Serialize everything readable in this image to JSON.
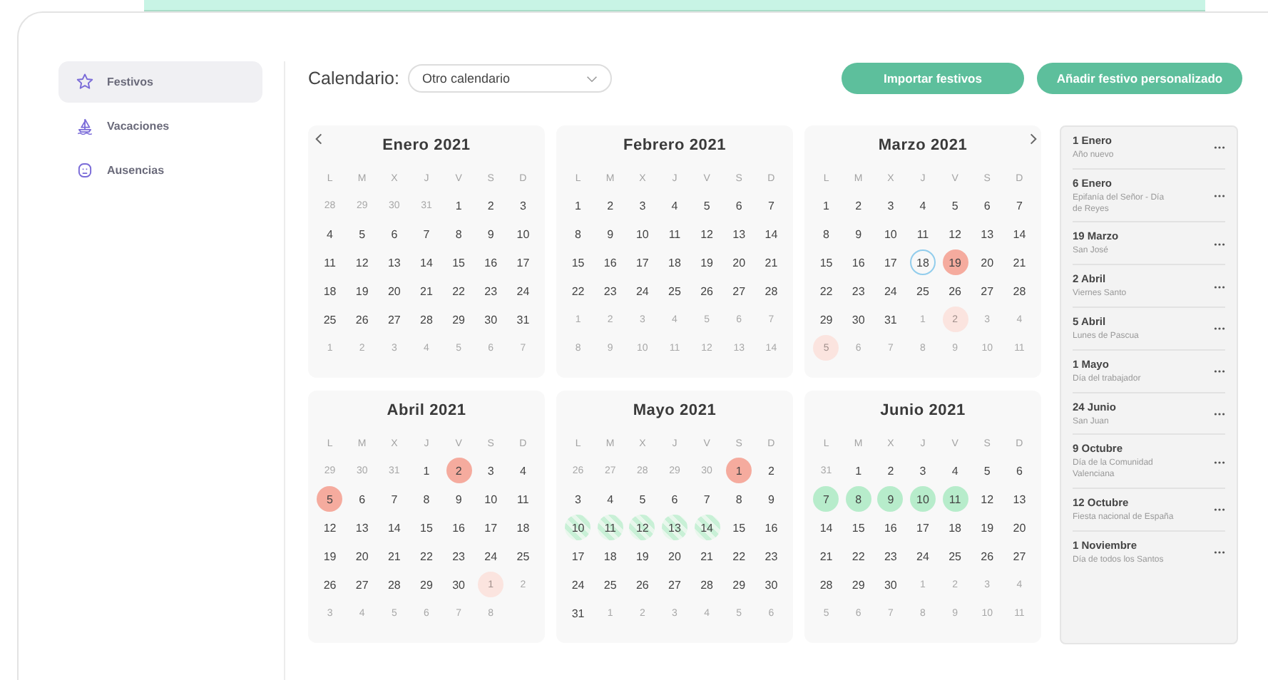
{
  "sidebar": {
    "items": [
      {
        "label": "Festivos",
        "selected": true
      },
      {
        "label": "Vacaciones",
        "selected": false
      },
      {
        "label": "Ausencias",
        "selected": false
      }
    ]
  },
  "toolbar": {
    "calendar_label": "Calendario:",
    "calendar_value": "Otro calendario",
    "buttons": [
      "Importar festivos",
      "Añadir festivo personalizado"
    ]
  },
  "months": [
    {
      "title": "Enero 2021",
      "weekdays": [
        "L",
        "M",
        "X",
        "J",
        "V",
        "S",
        "D"
      ],
      "weeks": [
        [
          {
            "d": "28",
            "kind": "out"
          },
          {
            "d": "29",
            "kind": "out"
          },
          {
            "d": "30",
            "kind": "out"
          },
          {
            "d": "31",
            "kind": "out"
          },
          {
            "d": "1",
            "kind": "in"
          },
          {
            "d": "2",
            "kind": "in"
          },
          {
            "d": "3",
            "kind": "in"
          }
        ],
        [
          {
            "d": "4",
            "kind": "in"
          },
          {
            "d": "5",
            "kind": "in"
          },
          {
            "d": "6",
            "kind": "in"
          },
          {
            "d": "7",
            "kind": "in"
          },
          {
            "d": "8",
            "kind": "in"
          },
          {
            "d": "9",
            "kind": "in"
          },
          {
            "d": "10",
            "kind": "in"
          }
        ],
        [
          {
            "d": "11",
            "kind": "in"
          },
          {
            "d": "12",
            "kind": "in"
          },
          {
            "d": "13",
            "kind": "in"
          },
          {
            "d": "14",
            "kind": "in"
          },
          {
            "d": "15",
            "kind": "in"
          },
          {
            "d": "16",
            "kind": "in"
          },
          {
            "d": "17",
            "kind": "in"
          }
        ],
        [
          {
            "d": "18",
            "kind": "in"
          },
          {
            "d": "19",
            "kind": "in"
          },
          {
            "d": "20",
            "kind": "in"
          },
          {
            "d": "21",
            "kind": "in"
          },
          {
            "d": "22",
            "kind": "in"
          },
          {
            "d": "23",
            "kind": "in"
          },
          {
            "d": "24",
            "kind": "in"
          }
        ],
        [
          {
            "d": "25",
            "kind": "in"
          },
          {
            "d": "26",
            "kind": "in"
          },
          {
            "d": "27",
            "kind": "in"
          },
          {
            "d": "28",
            "kind": "in"
          },
          {
            "d": "29",
            "kind": "in"
          },
          {
            "d": "30",
            "kind": "in"
          },
          {
            "d": "31",
            "kind": "in"
          }
        ],
        [
          {
            "d": "1",
            "kind": "out"
          },
          {
            "d": "2",
            "kind": "out"
          },
          {
            "d": "3",
            "kind": "out"
          },
          {
            "d": "4",
            "kind": "out"
          },
          {
            "d": "5",
            "kind": "out"
          },
          {
            "d": "6",
            "kind": "out"
          },
          {
            "d": "7",
            "kind": "out"
          }
        ]
      ]
    },
    {
      "title": "Febrero 2021",
      "weekdays": [
        "L",
        "M",
        "X",
        "J",
        "V",
        "S",
        "D"
      ],
      "weeks": [
        [
          {
            "d": "1",
            "kind": "in"
          },
          {
            "d": "2",
            "kind": "in"
          },
          {
            "d": "3",
            "kind": "in"
          },
          {
            "d": "4",
            "kind": "in"
          },
          {
            "d": "5",
            "kind": "in"
          },
          {
            "d": "6",
            "kind": "in"
          },
          {
            "d": "7",
            "kind": "in"
          }
        ],
        [
          {
            "d": "8",
            "kind": "in"
          },
          {
            "d": "9",
            "kind": "in"
          },
          {
            "d": "10",
            "kind": "in"
          },
          {
            "d": "11",
            "kind": "in"
          },
          {
            "d": "12",
            "kind": "in"
          },
          {
            "d": "13",
            "kind": "in"
          },
          {
            "d": "14",
            "kind": "in"
          }
        ],
        [
          {
            "d": "15",
            "kind": "in"
          },
          {
            "d": "16",
            "kind": "in"
          },
          {
            "d": "17",
            "kind": "in"
          },
          {
            "d": "18",
            "kind": "in"
          },
          {
            "d": "19",
            "kind": "in"
          },
          {
            "d": "20",
            "kind": "in"
          },
          {
            "d": "21",
            "kind": "in"
          }
        ],
        [
          {
            "d": "22",
            "kind": "in"
          },
          {
            "d": "23",
            "kind": "in"
          },
          {
            "d": "24",
            "kind": "in"
          },
          {
            "d": "25",
            "kind": "in"
          },
          {
            "d": "26",
            "kind": "in"
          },
          {
            "d": "27",
            "kind": "in"
          },
          {
            "d": "28",
            "kind": "in"
          }
        ],
        [
          {
            "d": "1",
            "kind": "out"
          },
          {
            "d": "2",
            "kind": "out"
          },
          {
            "d": "3",
            "kind": "out"
          },
          {
            "d": "4",
            "kind": "out"
          },
          {
            "d": "5",
            "kind": "out"
          },
          {
            "d": "6",
            "kind": "out"
          },
          {
            "d": "7",
            "kind": "out"
          }
        ],
        [
          {
            "d": "8",
            "kind": "out"
          },
          {
            "d": "9",
            "kind": "out"
          },
          {
            "d": "10",
            "kind": "out"
          },
          {
            "d": "11",
            "kind": "out"
          },
          {
            "d": "12",
            "kind": "out"
          },
          {
            "d": "13",
            "kind": "out"
          },
          {
            "d": "14",
            "kind": "out"
          }
        ]
      ]
    },
    {
      "title": "Marzo 2021",
      "weekdays": [
        "L",
        "M",
        "X",
        "J",
        "V",
        "S",
        "D"
      ],
      "weeks": [
        [
          {
            "d": "1",
            "kind": "in"
          },
          {
            "d": "2",
            "kind": "in"
          },
          {
            "d": "3",
            "kind": "in"
          },
          {
            "d": "4",
            "kind": "in"
          },
          {
            "d": "5",
            "kind": "in"
          },
          {
            "d": "6",
            "kind": "in"
          },
          {
            "d": "7",
            "kind": "in"
          }
        ],
        [
          {
            "d": "8",
            "kind": "in"
          },
          {
            "d": "9",
            "kind": "in"
          },
          {
            "d": "10",
            "kind": "in"
          },
          {
            "d": "11",
            "kind": "in"
          },
          {
            "d": "12",
            "kind": "in"
          },
          {
            "d": "13",
            "kind": "in"
          },
          {
            "d": "14",
            "kind": "in"
          }
        ],
        [
          {
            "d": "15",
            "kind": "in"
          },
          {
            "d": "16",
            "kind": "in"
          },
          {
            "d": "17",
            "kind": "in"
          },
          {
            "d": "18",
            "kind": "today"
          },
          {
            "d": "19",
            "kind": "holiday"
          },
          {
            "d": "20",
            "kind": "in"
          },
          {
            "d": "21",
            "kind": "in"
          }
        ],
        [
          {
            "d": "22",
            "kind": "in"
          },
          {
            "d": "23",
            "kind": "in"
          },
          {
            "d": "24",
            "kind": "in"
          },
          {
            "d": "25",
            "kind": "in"
          },
          {
            "d": "26",
            "kind": "in"
          },
          {
            "d": "27",
            "kind": "in"
          },
          {
            "d": "28",
            "kind": "in"
          }
        ],
        [
          {
            "d": "29",
            "kind": "in"
          },
          {
            "d": "30",
            "kind": "in"
          },
          {
            "d": "31",
            "kind": "in"
          },
          {
            "d": "1",
            "kind": "out"
          },
          {
            "d": "2",
            "kind": "holiday-out"
          },
          {
            "d": "3",
            "kind": "out"
          },
          {
            "d": "4",
            "kind": "out"
          }
        ],
        [
          {
            "d": "5",
            "kind": "holiday-out"
          },
          {
            "d": "6",
            "kind": "out"
          },
          {
            "d": "7",
            "kind": "out"
          },
          {
            "d": "8",
            "kind": "out"
          },
          {
            "d": "9",
            "kind": "out"
          },
          {
            "d": "10",
            "kind": "out"
          },
          {
            "d": "11",
            "kind": "out"
          }
        ]
      ]
    },
    {
      "title": "Abril 2021",
      "weekdays": [
        "L",
        "M",
        "X",
        "J",
        "V",
        "S",
        "D"
      ],
      "weeks": [
        [
          {
            "d": "29",
            "kind": "out"
          },
          {
            "d": "30",
            "kind": "out"
          },
          {
            "d": "31",
            "kind": "out"
          },
          {
            "d": "1",
            "kind": "in"
          },
          {
            "d": "2",
            "kind": "holiday"
          },
          {
            "d": "3",
            "kind": "in"
          },
          {
            "d": "4",
            "kind": "in"
          }
        ],
        [
          {
            "d": "5",
            "kind": "holiday"
          },
          {
            "d": "6",
            "kind": "in"
          },
          {
            "d": "7",
            "kind": "in"
          },
          {
            "d": "8",
            "kind": "in"
          },
          {
            "d": "9",
            "kind": "in"
          },
          {
            "d": "10",
            "kind": "in"
          },
          {
            "d": "11",
            "kind": "in"
          }
        ],
        [
          {
            "d": "12",
            "kind": "in"
          },
          {
            "d": "13",
            "kind": "in"
          },
          {
            "d": "14",
            "kind": "in"
          },
          {
            "d": "15",
            "kind": "in"
          },
          {
            "d": "16",
            "kind": "in"
          },
          {
            "d": "17",
            "kind": "in"
          },
          {
            "d": "18",
            "kind": "in"
          }
        ],
        [
          {
            "d": "19",
            "kind": "in"
          },
          {
            "d": "20",
            "kind": "in"
          },
          {
            "d": "21",
            "kind": "in"
          },
          {
            "d": "22",
            "kind": "in"
          },
          {
            "d": "23",
            "kind": "in"
          },
          {
            "d": "24",
            "kind": "in"
          },
          {
            "d": "25",
            "kind": "in"
          }
        ],
        [
          {
            "d": "26",
            "kind": "in"
          },
          {
            "d": "27",
            "kind": "in"
          },
          {
            "d": "28",
            "kind": "in"
          },
          {
            "d": "29",
            "kind": "in"
          },
          {
            "d": "30",
            "kind": "in"
          },
          {
            "d": "1",
            "kind": "holiday-out"
          },
          {
            "d": "2",
            "kind": "out"
          }
        ],
        [
          {
            "d": "3",
            "kind": "out"
          },
          {
            "d": "4",
            "kind": "out"
          },
          {
            "d": "5",
            "kind": "out"
          },
          {
            "d": "6",
            "kind": "out"
          },
          {
            "d": "7",
            "kind": "out"
          },
          {
            "d": "8",
            "kind": "out"
          }
        ]
      ]
    },
    {
      "title": "Mayo 2021",
      "weekdays": [
        "L",
        "M",
        "X",
        "J",
        "V",
        "S",
        "D"
      ],
      "weeks": [
        [
          {
            "d": "26",
            "kind": "out"
          },
          {
            "d": "27",
            "kind": "out"
          },
          {
            "d": "28",
            "kind": "out"
          },
          {
            "d": "29",
            "kind": "out"
          },
          {
            "d": "30",
            "kind": "out"
          },
          {
            "d": "1",
            "kind": "holiday"
          },
          {
            "d": "2",
            "kind": "in"
          }
        ],
        [
          {
            "d": "3",
            "kind": "in"
          },
          {
            "d": "4",
            "kind": "in"
          },
          {
            "d": "5",
            "kind": "in"
          },
          {
            "d": "6",
            "kind": "in"
          },
          {
            "d": "7",
            "kind": "in"
          },
          {
            "d": "8",
            "kind": "in"
          },
          {
            "d": "9",
            "kind": "in"
          }
        ],
        [
          {
            "d": "10",
            "kind": "pending"
          },
          {
            "d": "11",
            "kind": "pending"
          },
          {
            "d": "12",
            "kind": "pending"
          },
          {
            "d": "13",
            "kind": "pending"
          },
          {
            "d": "14",
            "kind": "pending"
          },
          {
            "d": "15",
            "kind": "in"
          },
          {
            "d": "16",
            "kind": "in"
          }
        ],
        [
          {
            "d": "17",
            "kind": "in"
          },
          {
            "d": "18",
            "kind": "in"
          },
          {
            "d": "19",
            "kind": "in"
          },
          {
            "d": "20",
            "kind": "in"
          },
          {
            "d": "21",
            "kind": "in"
          },
          {
            "d": "22",
            "kind": "in"
          },
          {
            "d": "23",
            "kind": "in"
          }
        ],
        [
          {
            "d": "24",
            "kind": "in"
          },
          {
            "d": "25",
            "kind": "in"
          },
          {
            "d": "26",
            "kind": "in"
          },
          {
            "d": "27",
            "kind": "in"
          },
          {
            "d": "28",
            "kind": "in"
          },
          {
            "d": "29",
            "kind": "in"
          },
          {
            "d": "30",
            "kind": "in"
          }
        ],
        [
          {
            "d": "31",
            "kind": "in"
          },
          {
            "d": "1",
            "kind": "out"
          },
          {
            "d": "2",
            "kind": "out"
          },
          {
            "d": "3",
            "kind": "out"
          },
          {
            "d": "4",
            "kind": "out"
          },
          {
            "d": "5",
            "kind": "out"
          },
          {
            "d": "6",
            "kind": "out"
          }
        ]
      ]
    },
    {
      "title": "Junio 2021",
      "weekdays": [
        "L",
        "M",
        "X",
        "J",
        "V",
        "S",
        "D"
      ],
      "weeks": [
        [
          {
            "d": "31",
            "kind": "out"
          },
          {
            "d": "1",
            "kind": "in"
          },
          {
            "d": "2",
            "kind": "in"
          },
          {
            "d": "3",
            "kind": "in"
          },
          {
            "d": "4",
            "kind": "in"
          },
          {
            "d": "5",
            "kind": "in"
          },
          {
            "d": "6",
            "kind": "in"
          }
        ],
        [
          {
            "d": "7",
            "kind": "vacation"
          },
          {
            "d": "8",
            "kind": "vacation"
          },
          {
            "d": "9",
            "kind": "vacation"
          },
          {
            "d": "10",
            "kind": "vacation"
          },
          {
            "d": "11",
            "kind": "vacation"
          },
          {
            "d": "12",
            "kind": "in"
          },
          {
            "d": "13",
            "kind": "in"
          }
        ],
        [
          {
            "d": "14",
            "kind": "in"
          },
          {
            "d": "15",
            "kind": "in"
          },
          {
            "d": "16",
            "kind": "in"
          },
          {
            "d": "17",
            "kind": "in"
          },
          {
            "d": "18",
            "kind": "in"
          },
          {
            "d": "19",
            "kind": "in"
          },
          {
            "d": "20",
            "kind": "in"
          }
        ],
        [
          {
            "d": "21",
            "kind": "in"
          },
          {
            "d": "22",
            "kind": "in"
          },
          {
            "d": "23",
            "kind": "in"
          },
          {
            "d": "24",
            "kind": "in"
          },
          {
            "d": "25",
            "kind": "in"
          },
          {
            "d": "26",
            "kind": "in"
          },
          {
            "d": "27",
            "kind": "in"
          }
        ],
        [
          {
            "d": "28",
            "kind": "in"
          },
          {
            "d": "29",
            "kind": "in"
          },
          {
            "d": "30",
            "kind": "in"
          },
          {
            "d": "1",
            "kind": "out"
          },
          {
            "d": "2",
            "kind": "out"
          },
          {
            "d": "3",
            "kind": "out"
          },
          {
            "d": "4",
            "kind": "out"
          }
        ],
        [
          {
            "d": "5",
            "kind": "out"
          },
          {
            "d": "6",
            "kind": "out"
          },
          {
            "d": "7",
            "kind": "out"
          },
          {
            "d": "8",
            "kind": "out"
          },
          {
            "d": "9",
            "kind": "out"
          },
          {
            "d": "10",
            "kind": "out"
          },
          {
            "d": "11",
            "kind": "out"
          }
        ]
      ]
    }
  ],
  "holidays": [
    {
      "date": "1 Enero",
      "name": "Año nuevo"
    },
    {
      "date": "6 Enero",
      "name": "Epifanía del Señor - Día de Reyes"
    },
    {
      "date": "19 Marzo",
      "name": "San José"
    },
    {
      "date": "2 Abril",
      "name": "Viernes Santo"
    },
    {
      "date": "5 Abril",
      "name": "Lunes de Pascua"
    },
    {
      "date": "1 Mayo",
      "name": "Día del trabajador"
    },
    {
      "date": "24 Junio",
      "name": "San Juan"
    },
    {
      "date": "9 Octubre",
      "name": "Día de la Comunidad Valenciana"
    },
    {
      "date": "12 Octubre",
      "name": "Fiesta nacional de España"
    },
    {
      "date": "1 Noviembre",
      "name": "Día de todos los Santos"
    }
  ]
}
